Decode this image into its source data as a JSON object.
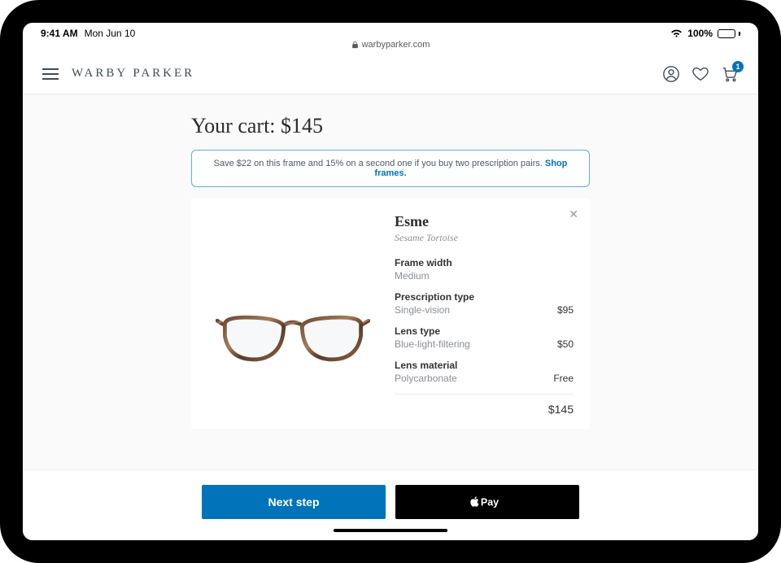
{
  "status": {
    "time": "9:41 AM",
    "date": "Mon Jun 10",
    "battery_pct": "100%"
  },
  "browser": {
    "url_host": "warbyparker.com"
  },
  "header": {
    "brand": "WARBY PARKER",
    "cart_count": "1"
  },
  "cart": {
    "title": "Your cart: $145",
    "promo_text": "Save $22 on this frame and 15% on a second one if you buy two prescription pairs. ",
    "promo_link": "Shop frames.",
    "item": {
      "name": "Esme",
      "color": "Sesame Tortoise",
      "specs": [
        {
          "label": "Frame width",
          "value": "Medium",
          "price": ""
        },
        {
          "label": "Prescription type",
          "value": "Single-vision",
          "price": "$95"
        },
        {
          "label": "Lens type",
          "value": "Blue-light-filtering",
          "price": "$50"
        },
        {
          "label": "Lens material",
          "value": "Polycarbonate",
          "price": "Free"
        }
      ],
      "total": "$145"
    }
  },
  "actions": {
    "next": "Next step",
    "apple_pay_label": "Pay"
  }
}
